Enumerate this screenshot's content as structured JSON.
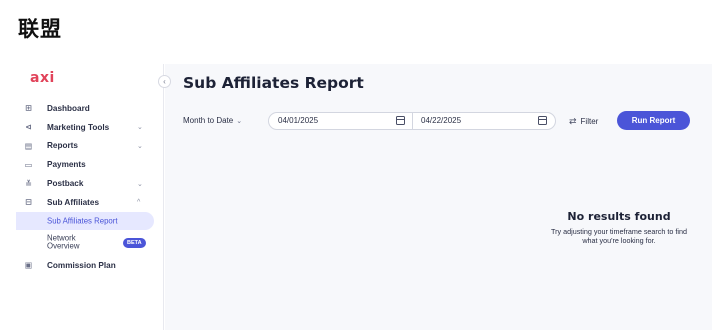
{
  "page": {
    "heading": "联盟"
  },
  "brand": {
    "logo": "axi",
    "color": "#e1435a"
  },
  "sidebar": {
    "items": [
      {
        "label": "Dashboard",
        "icon": "dashboard-icon",
        "chevron": ""
      },
      {
        "label": "Marketing Tools",
        "icon": "marketing-icon",
        "chevron": "⌄"
      },
      {
        "label": "Reports",
        "icon": "reports-icon",
        "chevron": "⌄"
      },
      {
        "label": "Payments",
        "icon": "payments-icon",
        "chevron": ""
      },
      {
        "label": "Postback",
        "icon": "postback-icon",
        "chevron": "⌄"
      },
      {
        "label": "Sub Affiliates",
        "icon": "sub-affiliates-icon",
        "chevron": "^"
      }
    ],
    "sub_items": [
      {
        "label": "Sub Affiliates Report",
        "active": true
      },
      {
        "label": "Network Overview",
        "badge": "BETA"
      }
    ],
    "last_item": {
      "label": "Commission Plan",
      "icon": "commission-icon"
    }
  },
  "main": {
    "title": "Sub Affiliates Report",
    "period": "Month to Date",
    "start_date": "04/01/2025",
    "end_date": "04/22/2025",
    "filter_label": "Filter",
    "run_button": "Run Report",
    "empty_title": "No results found",
    "empty_line1": "Try adjusting your timeframe search to find",
    "empty_line2": "what you're looking for."
  },
  "colors": {
    "accent": "#4b55d8",
    "active_bg": "#e6e8ff",
    "main_bg": "#f7f8fb"
  }
}
